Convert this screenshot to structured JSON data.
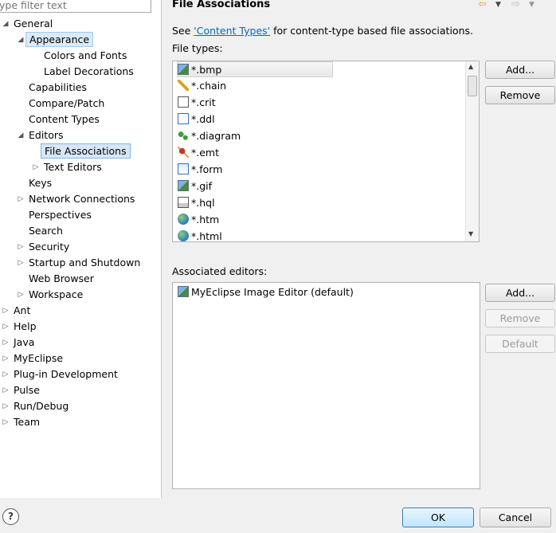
{
  "filter": {
    "placeholder": "ype filter text"
  },
  "tree": [
    {
      "label": "General",
      "arrow": "expanded"
    },
    {
      "label": "Appearance",
      "arrow": "expanded"
    },
    {
      "label": "Colors and Fonts",
      "arrow": "none"
    },
    {
      "label": "Label Decorations",
      "arrow": "none"
    },
    {
      "label": "Capabilities",
      "arrow": "none"
    },
    {
      "label": "Compare/Patch",
      "arrow": "none"
    },
    {
      "label": "Content Types",
      "arrow": "none"
    },
    {
      "label": "Editors",
      "arrow": "expanded"
    },
    {
      "label": "File Associations",
      "arrow": "none"
    },
    {
      "label": "Text Editors",
      "arrow": "collapsed"
    },
    {
      "label": "Keys",
      "arrow": "none"
    },
    {
      "label": "Network Connections",
      "arrow": "collapsed"
    },
    {
      "label": "Perspectives",
      "arrow": "none"
    },
    {
      "label": "Search",
      "arrow": "none"
    },
    {
      "label": "Security",
      "arrow": "collapsed"
    },
    {
      "label": "Startup and Shutdown",
      "arrow": "collapsed"
    },
    {
      "label": "Web Browser",
      "arrow": "none"
    },
    {
      "label": "Workspace",
      "arrow": "collapsed"
    },
    {
      "label": "Ant",
      "arrow": "collapsed"
    },
    {
      "label": "Help",
      "arrow": "collapsed"
    },
    {
      "label": "Java",
      "arrow": "collapsed"
    },
    {
      "label": "MyEclipse",
      "arrow": "collapsed"
    },
    {
      "label": "Plug-in Development",
      "arrow": "collapsed"
    },
    {
      "label": "Pulse",
      "arrow": "collapsed"
    },
    {
      "label": "Run/Debug",
      "arrow": "collapsed"
    },
    {
      "label": "Team",
      "arrow": "collapsed"
    }
  ],
  "page": {
    "title": "File Associations",
    "see_prefix": "See ",
    "see_link": "'Content Types'",
    "see_suffix": " for content-type based file associations.",
    "file_types_label": "File types:",
    "associated_label": "Associated editors:"
  },
  "file_types": [
    {
      "name": "*.bmp",
      "icon": "image-file-icon"
    },
    {
      "name": "*.chain",
      "icon": "chain-file-icon"
    },
    {
      "name": "*.crit",
      "icon": "crit-file-icon"
    },
    {
      "name": "*.ddl",
      "icon": "ddl-file-icon"
    },
    {
      "name": "*.diagram",
      "icon": "diagram-file-icon"
    },
    {
      "name": "*.emt",
      "icon": "emt-file-icon"
    },
    {
      "name": "*.form",
      "icon": "form-file-icon"
    },
    {
      "name": "*.gif",
      "icon": "image-file-icon"
    },
    {
      "name": "*.hql",
      "icon": "hql-file-icon"
    },
    {
      "name": "*.htm",
      "icon": "web-file-icon"
    },
    {
      "name": "*.html",
      "icon": "web-file-icon"
    }
  ],
  "editors": [
    {
      "name": "MyEclipse Image Editor (default)",
      "icon": "image-editor-icon"
    }
  ],
  "buttons": {
    "add_type": "Add...",
    "remove_type": "Remove",
    "add_editor": "Add...",
    "remove_editor": "Remove",
    "default_editor": "Default",
    "ok": "OK",
    "cancel": "Cancel",
    "help": "?"
  }
}
